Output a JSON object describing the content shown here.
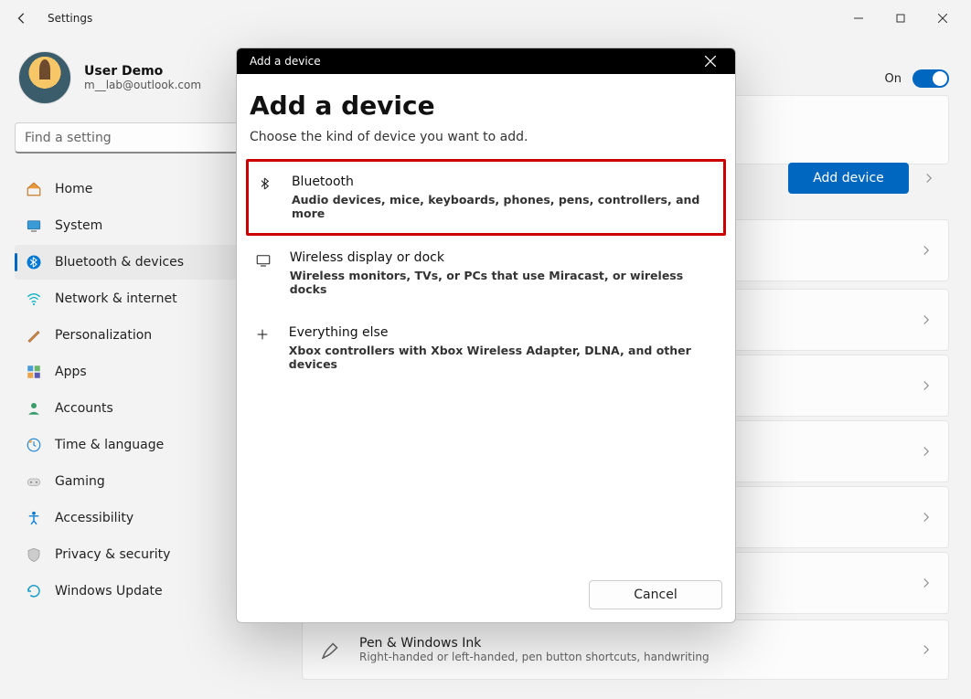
{
  "window": {
    "title": "Settings"
  },
  "user": {
    "name": "User Demo",
    "email": "m__lab@outlook.com"
  },
  "search": {
    "placeholder": "Find a setting"
  },
  "sidebar": {
    "items": [
      {
        "label": "Home",
        "icon": "home-icon"
      },
      {
        "label": "System",
        "icon": "system-icon"
      },
      {
        "label": "Bluetooth & devices",
        "icon": "bluetooth-icon",
        "active": true
      },
      {
        "label": "Network & internet",
        "icon": "wifi-icon"
      },
      {
        "label": "Personalization",
        "icon": "brush-icon"
      },
      {
        "label": "Apps",
        "icon": "apps-icon"
      },
      {
        "label": "Accounts",
        "icon": "account-icon"
      },
      {
        "label": "Time & language",
        "icon": "clock-icon"
      },
      {
        "label": "Gaming",
        "icon": "gaming-icon"
      },
      {
        "label": "Accessibility",
        "icon": "accessibility-icon"
      },
      {
        "label": "Privacy & security",
        "icon": "shield-icon"
      },
      {
        "label": "Windows Update",
        "icon": "update-icon"
      }
    ]
  },
  "main": {
    "bluetooth_toggle": {
      "label": "On",
      "state": true
    },
    "add_device_button": "Add device",
    "pen_row": {
      "title": "Pen & Windows Ink",
      "subtitle": "Right-handed or left-handed, pen button shortcuts, handwriting"
    }
  },
  "modal": {
    "titlebar": "Add a device",
    "heading": "Add a device",
    "subtitle": "Choose the kind of device you want to add.",
    "options": [
      {
        "icon": "bluetooth-icon",
        "title": "Bluetooth",
        "subtitle": "Audio devices, mice, keyboards, phones, pens, controllers, and more",
        "highlighted": true
      },
      {
        "icon": "display-icon",
        "title": "Wireless display or dock",
        "subtitle": "Wireless monitors, TVs, or PCs that use Miracast, or wireless docks"
      },
      {
        "icon": "plus-icon",
        "title": "Everything else",
        "subtitle": "Xbox controllers with Xbox Wireless Adapter, DLNA, and other devices"
      }
    ],
    "cancel": "Cancel"
  }
}
